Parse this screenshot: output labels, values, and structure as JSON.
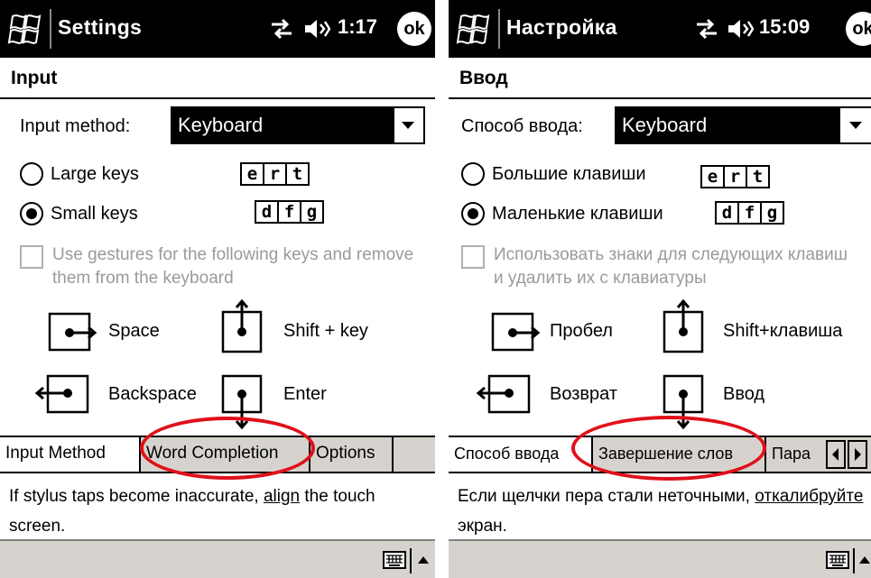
{
  "screens": {
    "en": {
      "app_title": "Settings",
      "time": "1:17",
      "ok_label": "ok",
      "page_header": "Input",
      "input_method_label": "Input method:",
      "input_method_value": "Keyboard",
      "radio_large": "Large keys",
      "radio_small": "Small keys",
      "gesture_checkbox_text": "Use gestures for the following keys and remove them from the keyboard",
      "gestures": {
        "space": "Space",
        "shift": "Shift + key",
        "backspace": "Backspace",
        "enter": "Enter"
      },
      "tabs": [
        "Input Method",
        "Word Completion",
        "Options"
      ],
      "note_prefix": "If stylus taps become inaccurate, ",
      "note_link": "align",
      "note_suffix": " the touch screen."
    },
    "ru": {
      "app_title": "Настройка",
      "time": "15:09",
      "ok_label": "ok",
      "page_header": "Ввод",
      "input_method_label": "Способ ввода:",
      "input_method_value": "Keyboard",
      "radio_large": "Большие клавиши",
      "radio_small": "Маленькие клавиши",
      "gesture_checkbox_text": "Использовать знаки для следующих клавиш и удалить их с клавиатуры",
      "gestures": {
        "space": "Пробел",
        "shift": "Shift+клавиша",
        "backspace": "Возврат",
        "enter": "Ввод"
      },
      "tabs": [
        "Способ ввода",
        "Завершение слов",
        "Пара"
      ],
      "note_prefix": "Если щелчки пера стали неточными, ",
      "note_link": "откалибруйте",
      "note_suffix": " экран."
    }
  },
  "key_preview": {
    "row1": [
      "e",
      "r",
      "t"
    ],
    "row2": [
      "d",
      "f",
      "g"
    ]
  },
  "state": {
    "input_method_selected": "Keyboard",
    "key_size": "small",
    "gestures_enabled": false,
    "active_tab": 0
  },
  "colors": {
    "titlebar": "#000000",
    "tabbar": "#d6d3ce",
    "highlight_annotation": "#e0101a",
    "disabled_text": "#9a9a9a"
  },
  "icons": [
    "windows-start-icon",
    "connectivity-icon",
    "volume-icon",
    "ok-button-icon",
    "dropdown-arrow-icon",
    "space-gesture-icon",
    "shift-gesture-icon",
    "backspace-gesture-icon",
    "enter-gesture-icon",
    "keyboard-icon",
    "sip-up-arrow-icon"
  ]
}
